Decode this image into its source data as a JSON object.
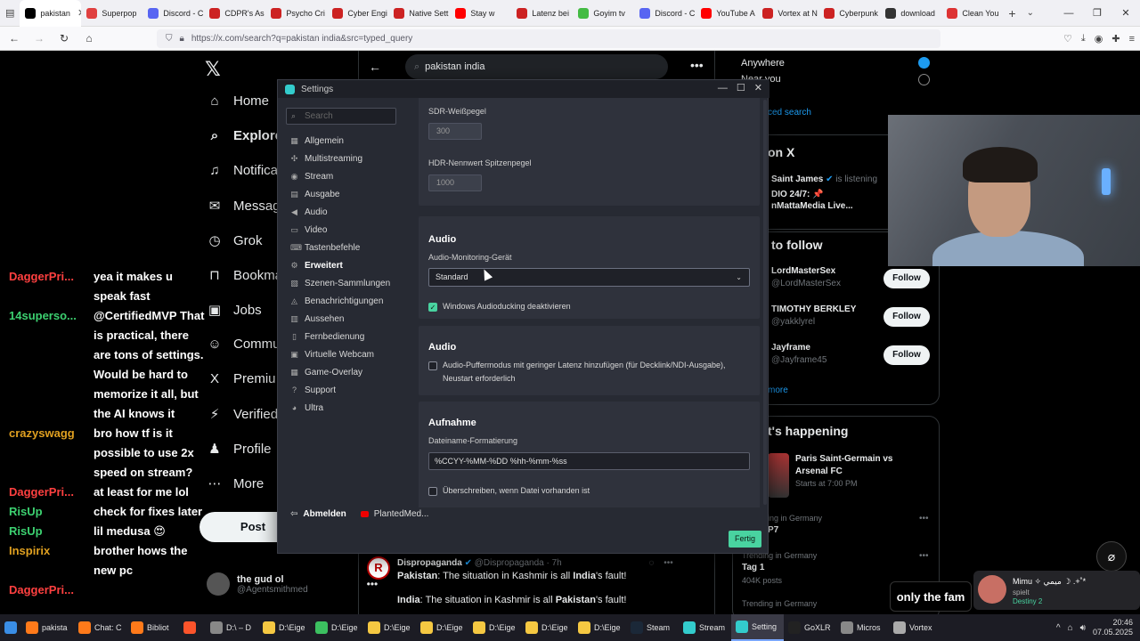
{
  "browser": {
    "tabs": [
      {
        "label": "pakistan",
        "color": "#000000",
        "active": true
      },
      {
        "label": "Superpop",
        "color": "#e04040",
        "active": false
      },
      {
        "label": "Discord - C",
        "color": "#5865f2",
        "active": false
      },
      {
        "label": "CDPR's As",
        "color": "#cc2222",
        "active": false
      },
      {
        "label": "Psycho Cri",
        "color": "#cc2222",
        "active": false
      },
      {
        "label": "Cyber Engi",
        "color": "#cc2222",
        "active": false
      },
      {
        "label": "Native Sett",
        "color": "#cc2222",
        "active": false
      },
      {
        "label": "Stay w",
        "color": "#ff0000",
        "active": false
      },
      {
        "label": "Latenz bei",
        "color": "#cc2222",
        "active": false
      },
      {
        "label": "Goyim tv",
        "color": "#44bb44",
        "active": false
      },
      {
        "label": "Discord - C",
        "color": "#5865f2",
        "active": false
      },
      {
        "label": "YouTube A",
        "color": "#ff0000",
        "active": false
      },
      {
        "label": "Vortex at N",
        "color": "#cc2222",
        "active": false
      },
      {
        "label": "Cyberpunk",
        "color": "#cc2222",
        "active": false
      },
      {
        "label": "download",
        "color": "#333333",
        "active": false
      },
      {
        "label": "Clean You",
        "color": "#dd3333",
        "active": false
      }
    ],
    "url": "https://x.com/search?q=pakistan india&src=typed_query"
  },
  "x": {
    "search_value": "pakistan india",
    "nav": [
      {
        "label": "Home",
        "icon": "⌂"
      },
      {
        "label": "Explore",
        "icon": "⌕"
      },
      {
        "label": "Notifica",
        "icon": "♫"
      },
      {
        "label": "Messag",
        "icon": "✉"
      },
      {
        "label": "Grok",
        "icon": "◷"
      },
      {
        "label": "Bookma",
        "icon": "⊓"
      },
      {
        "label": "Jobs",
        "icon": "▣"
      },
      {
        "label": "Commu",
        "icon": "☺"
      },
      {
        "label": "Premiu",
        "icon": "X"
      },
      {
        "label": "Verified",
        "icon": "⚡"
      },
      {
        "label": "Profile",
        "icon": "♟"
      },
      {
        "label": "More",
        "icon": "⋯"
      }
    ],
    "post_label": "Post",
    "profile_name": "the gud ol",
    "profile_handle": "@Agentsmithmed",
    "location_options": [
      "Anywhere",
      "Near you"
    ],
    "advanced_search": "ced search",
    "live_title": "on X",
    "live_user": "Saint James",
    "live_status": "is listening",
    "live_line1": "DIO 24/7: 📌",
    "live_line2": "nMattaMedia Live...",
    "who_to_follow_title": "to follow",
    "follow_label": "Follow",
    "suggestions": [
      {
        "name": "LordMasterSex",
        "handle": "@LordMasterSex"
      },
      {
        "name": "TIMOTHY BERKLEY",
        "handle": "@yakklyrel"
      },
      {
        "name": "Jayframe",
        "handle": "@Jayframe45"
      }
    ],
    "show_more": "more",
    "happening_title": "t's happening",
    "event_title1": "Paris Saint-Germain vs",
    "event_title2": "Arsenal FC",
    "event_time": "Starts at 7:00 PM",
    "trends": [
      {
        "ctx": "ing in Germany",
        "name": "P7",
        "count": ""
      },
      {
        "ctx": "Trending in Germany",
        "name": "Tag 1",
        "count": "404K posts"
      },
      {
        "ctx": "Trending in Germany",
        "name": "",
        "count": ""
      }
    ],
    "tweet": {
      "author": "Dispropaganda",
      "meta": "@Dispropaganda · 7h",
      "line1_a": "Pakistan",
      "line1_b": ": The situation in Kashmir is all ",
      "line1_c": "India",
      "line1_d": "'s fault!",
      "line2_a": "India",
      "line2_b": ": The situation in Kashmir is all ",
      "line2_c": "Pakistan",
      "line2_d": "'s fault!"
    }
  },
  "chat": [
    {
      "user": "DaggerPri...",
      "color": "#ff4040",
      "lines": [
        "yea it makes u",
        "speak fast"
      ]
    },
    {
      "user": "14superso...",
      "color": "#3cd070",
      "lines": [
        "@CertifiedMVP That",
        "is practical, there",
        "are tons of settings.",
        "Would be hard to",
        "memorize it all, but",
        "the AI knows it"
      ]
    },
    {
      "user": "crazyswagg",
      "color": "#e0a020",
      "lines": [
        "bro how tf is it",
        "possible to use 2x",
        "speed on stream?"
      ]
    },
    {
      "user": "DaggerPri...",
      "color": "#ff4040",
      "lines": [
        "at least for me lol"
      ]
    },
    {
      "user": "RisUp",
      "color": "#3cd070",
      "lines": [
        "check for fixes later"
      ]
    },
    {
      "user": "RisUp",
      "color": "#3cd070",
      "lines": [
        "lil medusa 😍"
      ]
    },
    {
      "user": "Inspirix",
      "color": "#e0a020",
      "lines": [
        "brother hows the",
        "new pc"
      ]
    },
    {
      "user": "DaggerPri...",
      "color": "#ff4040",
      "lines": []
    }
  ],
  "settings": {
    "title": "Settings",
    "search_placeholder": "Search",
    "menu": [
      {
        "label": "Allgemein",
        "icon": "▦"
      },
      {
        "label": "Multistreaming",
        "icon": "✣"
      },
      {
        "label": "Stream",
        "icon": "◉"
      },
      {
        "label": "Ausgabe",
        "icon": "▤"
      },
      {
        "label": "Audio",
        "icon": "◀"
      },
      {
        "label": "Video",
        "icon": "▭"
      },
      {
        "label": "Tastenbefehle",
        "icon": "⌨"
      },
      {
        "label": "Erweitert",
        "icon": "⚙"
      },
      {
        "label": "Szenen-Sammlungen",
        "icon": "▧"
      },
      {
        "label": "Benachrichtigungen",
        "icon": "◬"
      },
      {
        "label": "Aussehen",
        "icon": "▥"
      },
      {
        "label": "Fernbedienung",
        "icon": "▯"
      },
      {
        "label": "Virtuelle Webcam",
        "icon": "▣"
      },
      {
        "label": "Game-Overlay",
        "icon": "▦"
      },
      {
        "label": "Support",
        "icon": "?"
      },
      {
        "label": "Ultra",
        "icon": "◕"
      }
    ],
    "active_menu": "Erweitert",
    "sdr_label": "SDR-Weißpegel",
    "sdr_value": "300",
    "hdr_label": "HDR-Nennwert Spitzenpegel",
    "hdr_value": "1000",
    "audio1_title": "Audio",
    "monitor_label": "Audio-Monitoring-Gerät",
    "monitor_value": "Standard",
    "ducking_label": "Windows Audioducking deaktivieren",
    "ducking_checked": true,
    "audio2_title": "Audio",
    "buffer_label_1": "Audio-Puffermodus mit geringer Latenz hinzufügen (für Decklink/NDI-Ausgabe),",
    "buffer_label_2": "Neustart erforderlich",
    "buffer_checked": false,
    "rec_title": "Aufnahme",
    "filename_label": "Dateiname-Formatierung",
    "filename_value": "%CCYY-%MM-%DD %hh-%mm-%ss",
    "overwrite_label": "Überschreiben, wenn Datei vorhanden ist",
    "overwrite_checked": false,
    "logout_label": "Abmelden",
    "account_label": "PlantedMed...",
    "done_label": "Fertig"
  },
  "overlays": {
    "only_fam": "only the fam",
    "destiny_name": "Mimu ✧ ميمي ☽ .+˚*",
    "destiny_status": "spielt",
    "destiny_game": "Destiny 2"
  },
  "taskbar": {
    "items": [
      {
        "label": "pakista",
        "color": "#ff7a1a"
      },
      {
        "label": "Chat: C",
        "color": "#ff7a1a"
      },
      {
        "label": "Bibliot",
        "color": "#ff7a1a"
      },
      {
        "label": "",
        "color": "#fb542b"
      },
      {
        "label": "D:\\ – D",
        "color": "#888888"
      },
      {
        "label": "D:\\Eige",
        "color": "#f5c842"
      },
      {
        "label": "D:\\Eige",
        "color": "#3cc060"
      },
      {
        "label": "D:\\Eige",
        "color": "#f5c842"
      },
      {
        "label": "D:\\Eige",
        "color": "#f5c842"
      },
      {
        "label": "D:\\Eige",
        "color": "#f5c842"
      },
      {
        "label": "D:\\Eige",
        "color": "#f5c842"
      },
      {
        "label": "D:\\Eige",
        "color": "#f5c842"
      },
      {
        "label": "Steam",
        "color": "#1b2838"
      },
      {
        "label": "Stream",
        "color": "#3cc"
      },
      {
        "label": "Setting",
        "color": "#3cc"
      },
      {
        "label": "GoXLR",
        "color": "#222222"
      },
      {
        "label": "Micros",
        "color": "#888888"
      },
      {
        "label": "Vortex",
        "color": "#aaaaaa"
      }
    ],
    "time": "20:46",
    "date": "07.05.2025"
  }
}
